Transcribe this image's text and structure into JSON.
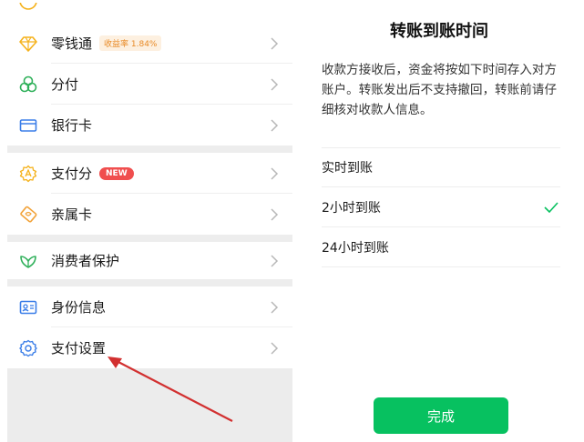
{
  "left_menu": {
    "items": [
      {
        "label": "零钱通",
        "badge": "收益率 1.84%",
        "icon": "diamond-icon"
      },
      {
        "label": "分付",
        "icon": "clover-icon"
      },
      {
        "label": "银行卡",
        "icon": "card-icon"
      },
      {
        "label": "支付分",
        "badge": "NEW",
        "icon": "score-icon"
      },
      {
        "label": "亲属卡",
        "icon": "family-card-icon"
      },
      {
        "label": "消费者保护",
        "icon": "shield-leaf-icon"
      },
      {
        "label": "身份信息",
        "icon": "id-card-icon"
      },
      {
        "label": "支付设置",
        "icon": "gear-icon"
      }
    ]
  },
  "transfer_dialog": {
    "title": "转账到账时间",
    "description": "收款方接收后，资金将按如下时间存入对方账户。转账发出后不支持撤回，转账前请仔细核对收款人信息。",
    "options": [
      {
        "label": "实时到账",
        "selected": false
      },
      {
        "label": "2小时到账",
        "selected": true
      },
      {
        "label": "24小时到账",
        "selected": false
      }
    ],
    "done_label": "完成"
  },
  "colors": {
    "accent_green": "#07c160",
    "new_badge": "#f04e4e",
    "rate_badge_text": "#e88a26",
    "icon_gold": "#f5b21c",
    "icon_green": "#2fb05a",
    "icon_blue": "#3b7ee8",
    "annotation_arrow": "#d23030"
  }
}
